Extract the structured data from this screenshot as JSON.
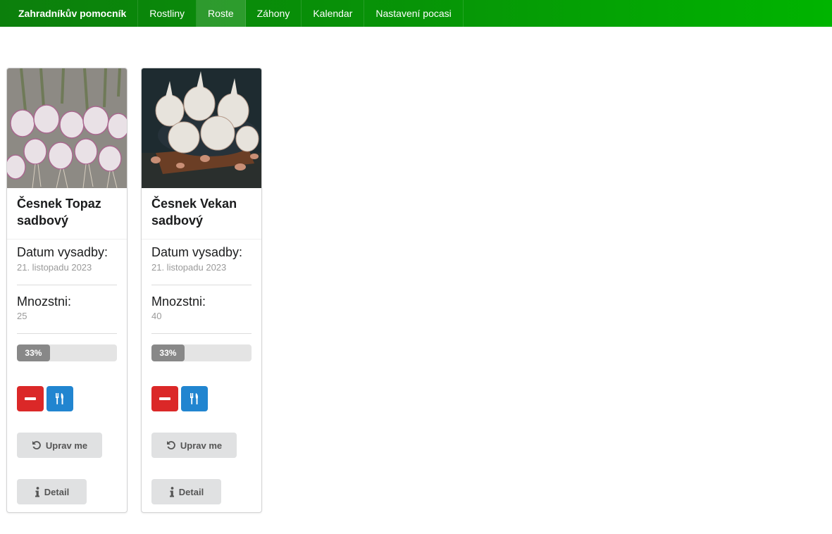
{
  "nav": {
    "brand": "Zahradníkův pomocník",
    "items": [
      {
        "label": "Rostliny",
        "active": false
      },
      {
        "label": "Roste",
        "active": true
      },
      {
        "label": "Záhony",
        "active": false
      },
      {
        "label": "Kalendar",
        "active": false
      },
      {
        "label": "Nastavení pocasi",
        "active": false
      }
    ]
  },
  "cards": [
    {
      "title": "Česnek Topaz sadbový",
      "date_label": "Datum vysadby:",
      "date_value": "21. listopadu 2023",
      "qty_label": "Mnozstni:",
      "qty_value": "25",
      "progress_percent": 33,
      "progress_text": "33%",
      "edit_label": "Uprav me",
      "detail_label": "Detail"
    },
    {
      "title": "Česnek Vekan sadbový",
      "date_label": "Datum vysadby:",
      "date_value": "21. listopadu 2023",
      "qty_label": "Mnozstni:",
      "qty_value": "40",
      "progress_percent": 33,
      "progress_text": "33%",
      "edit_label": "Uprav me",
      "detail_label": "Detail"
    }
  ],
  "icons": {
    "remove": "minus-icon",
    "harvest": "utensils-icon",
    "edit": "undo-icon",
    "detail": "info-icon"
  },
  "colors": {
    "nav_gradient_start": "#0c7f0c",
    "nav_gradient_end": "#00b400",
    "danger": "#db2828",
    "primary": "#2185d0",
    "progress_fill": "#888888",
    "button_gray": "#e0e1e2"
  }
}
